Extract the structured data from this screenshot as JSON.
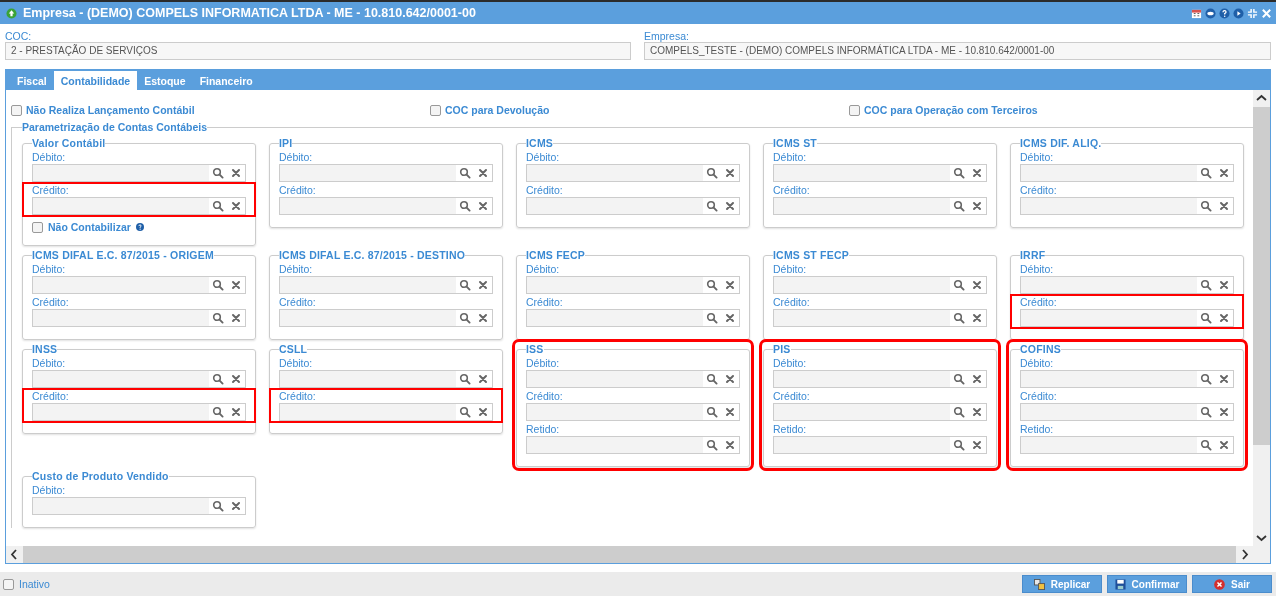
{
  "window": {
    "title": "Empresa - (DEMO) COMPELS INFORMATICA LTDA - ME - 10.810.642/0001-00"
  },
  "header_fields": [
    {
      "label": "COC:",
      "value": "2 - PRESTAÇÃO DE SERVIÇOS"
    },
    {
      "label": "Empresa:",
      "value": "COMPELS_TESTE - (DEMO) COMPELS INFORMÁTICA LTDA - ME - 10.810.642/0001-00"
    }
  ],
  "tabs": [
    {
      "label": "Fiscal",
      "selected": false
    },
    {
      "label": "Contabilidade",
      "selected": true
    },
    {
      "label": "Estoque",
      "selected": false
    },
    {
      "label": "Financeiro",
      "selected": false
    }
  ],
  "options": [
    {
      "label": "Não Realiza Lançamento Contábil",
      "checked": false
    },
    {
      "label": "COC para Devolução",
      "checked": false
    },
    {
      "label": "COC para Operação com Terceiros",
      "checked": false
    }
  ],
  "section": {
    "title": "Parametrização de Contas Contábeis",
    "groups": [
      {
        "title": "Valor Contábil",
        "highlighted": false,
        "fields": [
          {
            "label": "Débito:",
            "highlighted": false
          },
          {
            "label": "Crédito:",
            "highlighted": true
          }
        ],
        "option": {
          "label": "Não Contabilizar",
          "checked": false
        }
      },
      {
        "title": "IPI",
        "highlighted": false,
        "fields": [
          {
            "label": "Débito:",
            "highlighted": false
          },
          {
            "label": "Crédito:",
            "highlighted": false
          }
        ]
      },
      {
        "title": "ICMS",
        "highlighted": false,
        "fields": [
          {
            "label": "Débito:",
            "highlighted": false
          },
          {
            "label": "Crédito:",
            "highlighted": false
          }
        ]
      },
      {
        "title": "ICMS ST",
        "highlighted": false,
        "fields": [
          {
            "label": "Débito:",
            "highlighted": false
          },
          {
            "label": "Crédito:",
            "highlighted": false
          }
        ]
      },
      {
        "title": "ICMS DIF. ALIQ.",
        "highlighted": false,
        "fields": [
          {
            "label": "Débito:",
            "highlighted": false
          },
          {
            "label": "Crédito:",
            "highlighted": false
          }
        ]
      },
      {
        "title": "ICMS DIFAL E.C. 87/2015 - ORIGEM",
        "highlighted": false,
        "fields": [
          {
            "label": "Débito:",
            "highlighted": false
          },
          {
            "label": "Crédito:",
            "highlighted": false
          }
        ]
      },
      {
        "title": "ICMS DIFAL E.C. 87/2015 - DESTINO",
        "highlighted": false,
        "fields": [
          {
            "label": "Débito:",
            "highlighted": false
          },
          {
            "label": "Crédito:",
            "highlighted": false
          }
        ]
      },
      {
        "title": "ICMS FECP",
        "highlighted": false,
        "fields": [
          {
            "label": "Débito:",
            "highlighted": false
          },
          {
            "label": "Crédito:",
            "highlighted": false
          }
        ]
      },
      {
        "title": "ICMS ST FECP",
        "highlighted": false,
        "fields": [
          {
            "label": "Débito:",
            "highlighted": false
          },
          {
            "label": "Crédito:",
            "highlighted": false
          }
        ]
      },
      {
        "title": "IRRF",
        "highlighted": false,
        "fields": [
          {
            "label": "Débito:",
            "highlighted": false
          },
          {
            "label": "Crédito:",
            "highlighted": true
          }
        ]
      },
      {
        "title": "INSS",
        "highlighted": false,
        "fields": [
          {
            "label": "Débito:",
            "highlighted": false
          },
          {
            "label": "Crédito:",
            "highlighted": true
          }
        ]
      },
      {
        "title": "CSLL",
        "highlighted": false,
        "fields": [
          {
            "label": "Débito:",
            "highlighted": false
          },
          {
            "label": "Crédito:",
            "highlighted": true
          }
        ]
      },
      {
        "title": "ISS",
        "highlighted": true,
        "fields": [
          {
            "label": "Débito:",
            "highlighted": false
          },
          {
            "label": "Crédito:",
            "highlighted": false
          },
          {
            "label": "Retido:",
            "highlighted": false
          }
        ]
      },
      {
        "title": "PIS",
        "highlighted": true,
        "fields": [
          {
            "label": "Débito:",
            "highlighted": false
          },
          {
            "label": "Crédito:",
            "highlighted": false
          },
          {
            "label": "Retido:",
            "highlighted": false
          }
        ]
      },
      {
        "title": "COFINS",
        "highlighted": true,
        "fields": [
          {
            "label": "Débito:",
            "highlighted": false
          },
          {
            "label": "Crédito:",
            "highlighted": false
          },
          {
            "label": "Retido:",
            "highlighted": false
          }
        ]
      },
      {
        "title": "Custo de Produto Vendido",
        "highlighted": false,
        "fields": [
          {
            "label": "Débito:",
            "highlighted": false
          }
        ]
      }
    ]
  },
  "footer": {
    "inactive": {
      "label": "Inativo",
      "checked": false
    },
    "buttons": [
      {
        "label": "Replicar",
        "kind": "replicate"
      },
      {
        "label": "Confirmar",
        "kind": "confirm"
      },
      {
        "label": "Sair",
        "kind": "exit"
      }
    ]
  }
}
